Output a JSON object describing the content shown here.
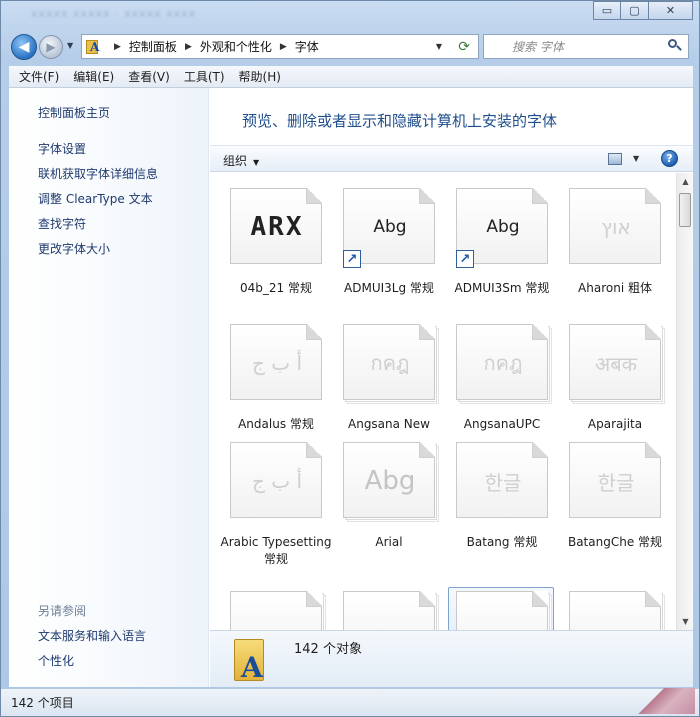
{
  "window": {
    "blurred_title": "xxxxx xxxxx · xxxxx xxxx",
    "controls": {
      "minimize": "▭",
      "maximize": "▢",
      "close": "✕"
    }
  },
  "address_bar": {
    "crumbs": [
      "控制面板",
      "外观和个性化",
      "字体"
    ],
    "search_placeholder": "搜索 字体"
  },
  "menu": [
    "文件(F)",
    "编辑(E)",
    "查看(V)",
    "工具(T)",
    "帮助(H)"
  ],
  "sidebar": {
    "home_link": "控制面板主页",
    "links": [
      "字体设置",
      "联机获取字体详细信息",
      "调整 ClearType 文本",
      "查找字符",
      "更改字体大小"
    ],
    "see_also_heading": "另请参阅",
    "see_also_links": [
      "文本服务和输入语言",
      "个性化"
    ]
  },
  "main": {
    "title": "预览、删除或者显示和隐藏计算机上安装的字体",
    "organize_label": "组织",
    "fonts": [
      {
        "name": "04b_21 常规",
        "sample": "ARX",
        "style": "dark",
        "stack": false,
        "shortcut": false
      },
      {
        "name": "ADMUI3Lg 常规",
        "sample": "Abg",
        "style": "dark",
        "stack": false,
        "shortcut": true
      },
      {
        "name": "ADMUI3Sm 常规",
        "sample": "Abg",
        "style": "dark",
        "stack": false,
        "shortcut": true
      },
      {
        "name": "Aharoni 粗体",
        "sample": "אוץ",
        "style": "light",
        "stack": false,
        "shortcut": false
      },
      {
        "name": "Andalus 常规",
        "sample": "أ ب ج",
        "style": "light",
        "stack": false,
        "shortcut": false
      },
      {
        "name": "Angsana New",
        "sample": "กคฎ",
        "style": "light",
        "stack": true,
        "shortcut": false
      },
      {
        "name": "AngsanaUPC",
        "sample": "กคฎ",
        "style": "light",
        "stack": true,
        "shortcut": false
      },
      {
        "name": "Aparajita",
        "sample": "अबक",
        "style": "light",
        "stack": true,
        "shortcut": false
      },
      {
        "name": "Arabic Typesetting 常规",
        "sample": "أ ب ج",
        "style": "light",
        "stack": false,
        "shortcut": false
      },
      {
        "name": "Arial",
        "sample": "Abg",
        "style": "light",
        "stack": true,
        "shortcut": false
      },
      {
        "name": "Batang 常规",
        "sample": "한글",
        "style": "light",
        "stack": false,
        "shortcut": false
      },
      {
        "name": "BatangChe 常规",
        "sample": "한글",
        "style": "light",
        "stack": false,
        "shortcut": false
      }
    ],
    "details_count": "142 个对象"
  },
  "status_bar": {
    "text": "142 个项目"
  },
  "icons": [
    "back-arrow-icon",
    "forward-arrow-icon",
    "fonts-folder-icon",
    "refresh-icon",
    "search-icon",
    "view-options-icon",
    "help-icon",
    "shortcut-arrow-icon"
  ],
  "colors": {
    "link": "#1e3a6e",
    "title": "#1f4e8c",
    "chrome": "#b5cde9"
  }
}
